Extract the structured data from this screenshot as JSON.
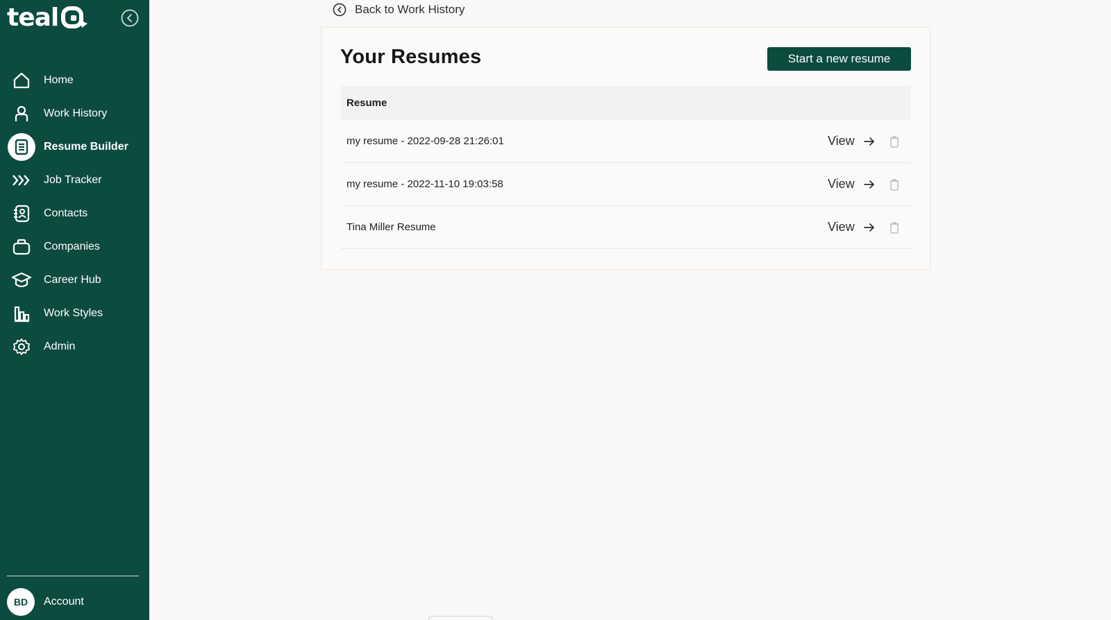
{
  "sidebar": {
    "logo_text": "teal",
    "nav": [
      {
        "label": "Home",
        "icon": "home-icon"
      },
      {
        "label": "Work History",
        "icon": "person-icon"
      },
      {
        "label": "Resume Builder",
        "icon": "document-icon",
        "active": true
      },
      {
        "label": "Job Tracker",
        "icon": "chevrons-right-icon"
      },
      {
        "label": "Contacts",
        "icon": "contact-book-icon"
      },
      {
        "label": "Companies",
        "icon": "briefcase-icon"
      },
      {
        "label": "Career Hub",
        "icon": "graduation-cap-icon"
      },
      {
        "label": "Work Styles",
        "icon": "bar-chart-icon"
      },
      {
        "label": "Admin",
        "icon": "gear-icon"
      }
    ],
    "account": {
      "initials": "BD",
      "label": "Account"
    }
  },
  "main": {
    "back_label": "Back to Work History",
    "title": "Your Resumes",
    "new_button_label": "Start a new resume",
    "table": {
      "column_header": "Resume",
      "rows": [
        {
          "name": "my resume - 2022-09-28 21:26:01",
          "action": "View"
        },
        {
          "name": "my resume - 2022-11-10 19:03:58",
          "action": "View"
        },
        {
          "name": "Tina Miller Resume",
          "action": "View"
        }
      ]
    }
  },
  "colors": {
    "brand": "#0c4b40",
    "background": "#faf8f7"
  }
}
